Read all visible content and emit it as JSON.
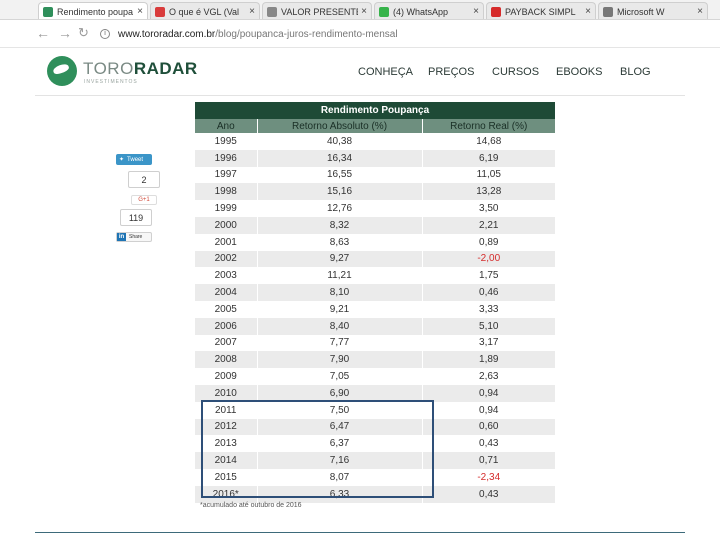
{
  "browser": {
    "tabs": [
      {
        "title": "Rendimento poupa",
        "favicon_color": "#2f8f5b",
        "active": true
      },
      {
        "title": "O que é VGL (Val",
        "favicon_color": "#d93b3b",
        "active": false
      },
      {
        "title": "VALOR PRESENTE",
        "favicon_color": "#888888",
        "active": false
      },
      {
        "title": "(4) WhatsApp",
        "favicon_color": "#36b34a",
        "active": false
      },
      {
        "title": "PAYBACK SIMPL",
        "favicon_color": "#d62b2b",
        "active": false
      },
      {
        "title": "Microsoft W",
        "favicon_color": "#777777",
        "active": false
      }
    ],
    "url_host": "www.tororadar.com.br",
    "url_path": "/blog/poupanca-juros-rendimento-mensal"
  },
  "site": {
    "logo_toro": "TORO",
    "logo_radar": "RADAR",
    "logo_tagline": "INVESTIMENTOS",
    "nav": [
      "CONHEÇA",
      "PREÇOS",
      "CURSOS",
      "EBOOKS",
      "BLOG"
    ]
  },
  "social": {
    "tweet_label": "Tweet",
    "tweet_count": "2",
    "gplus_label": "G+1",
    "gplus_count": "119",
    "linkedin_label": "Share"
  },
  "table": {
    "title": "Rendimento Poupança",
    "headers": [
      "Ano",
      "Retorno Absoluto (%)",
      "Retorno Real (%)"
    ],
    "rows": [
      [
        "1995",
        "40,38",
        "14,68"
      ],
      [
        "1996",
        "16,34",
        "6,19"
      ],
      [
        "1997",
        "16,55",
        "11,05"
      ],
      [
        "1998",
        "15,16",
        "13,28"
      ],
      [
        "1999",
        "12,76",
        "3,50"
      ],
      [
        "2000",
        "8,32",
        "2,21"
      ],
      [
        "2001",
        "8,63",
        "0,89"
      ],
      [
        "2002",
        "9,27",
        "-2,00"
      ],
      [
        "2003",
        "11,21",
        "1,75"
      ],
      [
        "2004",
        "8,10",
        "0,46"
      ],
      [
        "2005",
        "9,21",
        "3,33"
      ],
      [
        "2006",
        "8,40",
        "5,10"
      ],
      [
        "2007",
        "7,77",
        "3,17"
      ],
      [
        "2008",
        "7,90",
        "1,89"
      ],
      [
        "2009",
        "7,05",
        "2,63"
      ],
      [
        "2010",
        "6,90",
        "0,94"
      ],
      [
        "2011",
        "7,50",
        "0,94"
      ],
      [
        "2012",
        "6,47",
        "0,60"
      ],
      [
        "2013",
        "6,37",
        "0,43"
      ],
      [
        "2014",
        "7,16",
        "0,71"
      ],
      [
        "2015",
        "8,07",
        "-2,34"
      ],
      [
        "2016*",
        "6,33",
        "0,43"
      ]
    ],
    "negative_color": "#d52b2b",
    "highlighted_years": [
      "2011",
      "2012",
      "2013",
      "2014",
      "2015",
      "2016*"
    ],
    "footnote": "*acumulado até outubro de 2016"
  },
  "colors": {
    "title_bg": "#1e4a36",
    "header_bg": "#6e8f7f",
    "highlight_border": "#2e4f78"
  }
}
